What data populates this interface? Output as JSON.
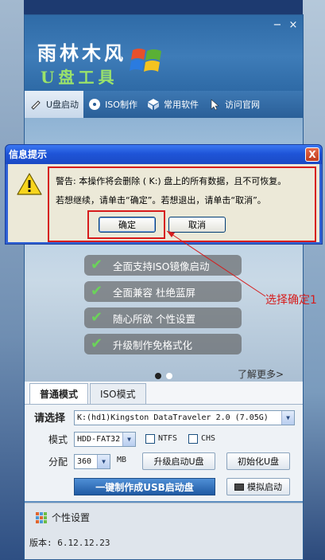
{
  "app": {
    "logo_title": "雨林木风",
    "logo_subtitle": "U盘工具",
    "window_controls": {
      "minimize": "−",
      "close": "×"
    },
    "tabs": [
      {
        "label": "U盘启动",
        "icon": "usb-icon",
        "active": true
      },
      {
        "label": "ISO制作",
        "icon": "disc-icon",
        "active": false
      },
      {
        "label": "常用软件",
        "icon": "package-icon",
        "active": false
      },
      {
        "label": "访问官网",
        "icon": "cursor-icon",
        "active": false
      }
    ],
    "features": [
      "全面支持ISO镜像启动",
      "全面兼容 杜绝蓝屏",
      "随心所欲 个性设置",
      "升级制作免格式化"
    ],
    "more_link": "了解更多>",
    "mode_tabs": [
      "普通模式",
      "ISO模式"
    ],
    "select_label": "请选择",
    "disk_select": "K:(hd1)Kingston DataTraveler 2.0 (7.05G)",
    "mode_label": "模式",
    "mode_select": "HDD-FAT32",
    "ntfs_label": "NTFS",
    "chs_label": "CHS",
    "partition_label": "分配",
    "partition_select": "360",
    "partition_unit": "MB",
    "upgrade_button": "升级启动U盘",
    "init_button": "初始化U盘",
    "make_button": "一键制作成USB启动盘",
    "simulate_button": "模拟启动",
    "personal_settings": "个性设置",
    "version": "版本: 6.12.12.23"
  },
  "dialog": {
    "title": "信息提示",
    "close": "X",
    "message_line1": "警告: 本操作将会删除 ( K:) 盘上的所有数据，且不可恢复。",
    "message_line2": "若想继续，请单击“确定”。若想退出，请单击“取消”。",
    "ok_label": "确定",
    "cancel_label": "取消"
  },
  "annotation": {
    "text": "选择确定1",
    "color": "#d61c1c"
  },
  "colors": {
    "accent_red": "#d61c1c",
    "xp_title_blue": "#1f55d8",
    "app_blue": "#2f6ba7",
    "feature_check_green": "#6bd35a"
  }
}
